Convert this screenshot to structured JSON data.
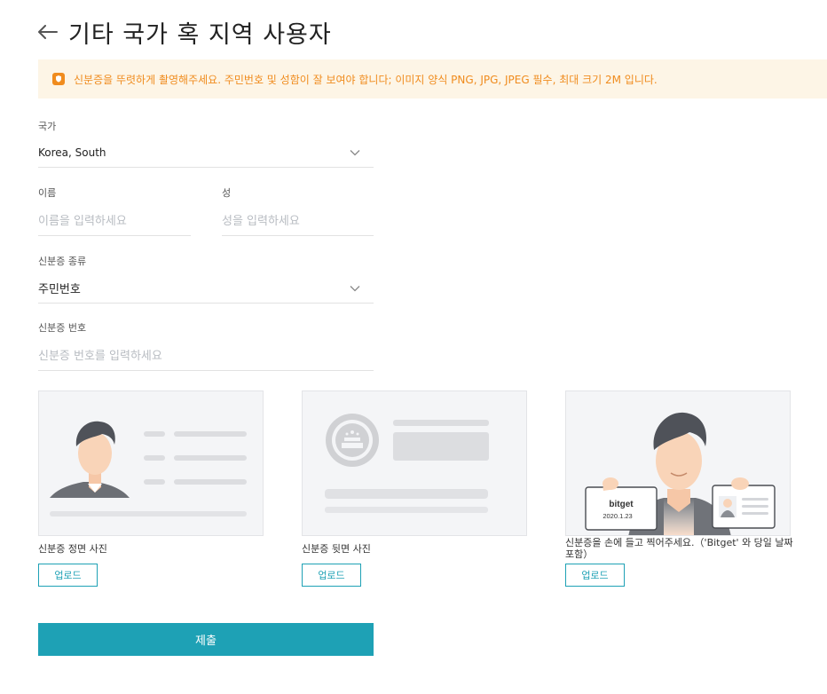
{
  "header": {
    "title": "기타 국가 혹 지역 사용자",
    "back_icon": "arrow-left-icon"
  },
  "notice": {
    "icon": "shield-icon",
    "text": "신분증을 뚜렷하게 촬영해주세요. 주민번호 및 성함이 잘 보여야 합니다;  이미지 양식 PNG, JPG, JPEG 필수, 최대 크기 2M 입니다."
  },
  "form": {
    "country": {
      "label": "국가",
      "value": "Korea, South"
    },
    "first_name": {
      "label": "이름",
      "placeholder": "이름을 입력하세요",
      "value": ""
    },
    "last_name": {
      "label": "성",
      "placeholder": "성을 입력하세요",
      "value": ""
    },
    "id_type": {
      "label": "신분증 종류",
      "value": "주민번호"
    },
    "id_number": {
      "label": "신분증 번호",
      "placeholder": "신분증 번호를 입력하세요",
      "value": ""
    }
  },
  "uploads": [
    {
      "caption": "신분증 정면 사진",
      "button": "업로드"
    },
    {
      "caption": "신분증 뒷면 사진",
      "button": "업로드"
    },
    {
      "caption": "신분증을 손에 들고 찍어주세요.（'Bitget' 와 당일 날짜 포함）",
      "button": "업로드",
      "sign_text": "bitget",
      "sign_date": "2020.1.23"
    }
  ],
  "submit_label": "제출",
  "colors": {
    "accent": "#1ea1b5",
    "notice_bg": "#fdf5e6",
    "notice_text": "#f08c1e"
  }
}
